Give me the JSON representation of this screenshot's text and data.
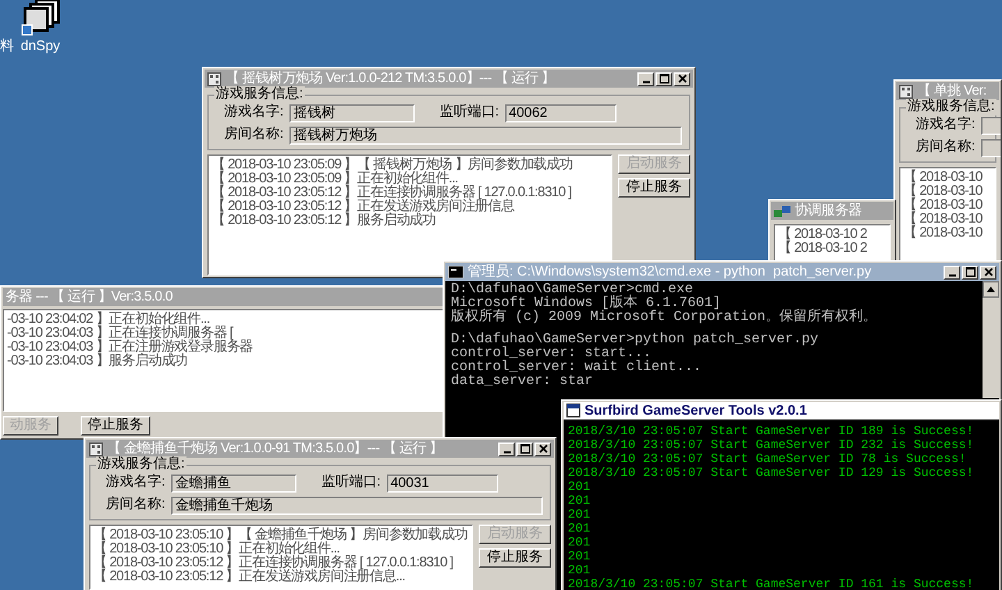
{
  "desktop_icons": [
    {
      "kind": "cut",
      "label": "料"
    },
    {
      "kind": "app",
      "label": "dnSpy"
    }
  ],
  "windows": [
    {
      "kind": "panel",
      "title": "务器 --- 【 运行 】Ver:3.5.0.0",
      "log": [
        "-03-10 23:04:02 】正在初始化组件...",
        "-03-10 23:04:03 】正在连接协调服务器 [",
        "-03-10 23:04:03 】正在注册游戏登录服务器",
        "-03-10 23:04:03 】服务启动成功"
      ],
      "buttons": [
        {
          "label": "动服务",
          "disabled": true
        },
        {
          "label": "停止服务",
          "disabled": false
        }
      ]
    },
    {
      "kind": "form",
      "title": "【 单挑 Ver:",
      "group_title": "游戏服务信息:",
      "field_rows": [
        {
          "fields": [
            {
              "label": "游戏名字:"
            }
          ]
        },
        {
          "fields": [
            {
              "label": "房间名称:"
            }
          ]
        }
      ],
      "log": [
        "【 2018-03-10",
        "【 2018-03-10",
        "【 2018-03-10",
        "【 2018-03-10",
        "【 2018-03-10"
      ]
    },
    {
      "kind": "form",
      "title": "协调服务器",
      "log": [
        "【 2018-03-10 2",
        "【 2018-03-10 2"
      ]
    },
    {
      "kind": "form",
      "title": "【 摇钱树万炮场 Ver:1.0.0-212 TM:3.5.0.0】--- 【 运行 】",
      "group_title": "游戏服务信息:",
      "field_rows": [
        {
          "fields": [
            {
              "label": "游戏名字:",
              "value": "摇钱树"
            },
            {
              "label": "监听端口:",
              "value": "40062"
            }
          ]
        },
        {
          "fields": [
            {
              "label": "房间名称:",
              "value": "摇钱树万炮场"
            }
          ]
        }
      ],
      "log": [
        "【 2018-03-10 23:05:09 】【 摇钱树万炮场 】房间参数加载成功",
        "【 2018-03-10 23:05:09 】正在初始化组件...",
        "【 2018-03-10 23:05:12 】正在连接协调服务器 [ 127.0.0.1:8310 ]",
        "【 2018-03-10 23:05:12 】正在发送游戏房间注册信息",
        "【 2018-03-10 23:05:12 】服务启动成功"
      ],
      "buttons": [
        {
          "label": "启动服务",
          "disabled": true
        },
        {
          "label": "停止服务",
          "disabled": false
        }
      ]
    },
    {
      "kind": "cmd",
      "title": "管理员: C:\\Windows\\system32\\cmd.exe - python  patch_server.py",
      "blocks": [
        {
          "lines": [
            "D:\\dafuhao\\GameServer>cmd.exe",
            "Microsoft Windows [版本 6.1.7601]",
            "版权所有 (c) 2009 Microsoft Corporation。保留所有权利。"
          ]
        },
        {
          "lines": [
            "D:\\dafuhao\\GameServer>python patch_server.py",
            "control_server: start...",
            "control_server: wait client...",
            "data_server: star"
          ]
        }
      ]
    },
    {
      "kind": "form",
      "title": "【 金蟾捕鱼千炮场 Ver:1.0.0-91 TM:3.5.0.0】--- 【 运行 】",
      "group_title": "游戏服务信息:",
      "field_rows": [
        {
          "fields": [
            {
              "label": "游戏名字:",
              "value": "金蟾捕鱼"
            },
            {
              "label": "监听端口:",
              "value": "40031"
            }
          ]
        },
        {
          "fields": [
            {
              "label": "房间名称:",
              "value": "金蟾捕鱼千炮场"
            }
          ]
        }
      ],
      "log": [
        "【 2018-03-10 23:05:10 】【 金蟾捕鱼千炮场 】房间参数加载成功",
        "【 2018-03-10 23:05:10 】正在初始化组件...",
        "【 2018-03-10 23:05:12 】正在连接协调服务器 [ 127.0.0.1:8310 ]",
        "【 2018-03-10 23:05:12 】正在发送游戏房间注册信息..."
      ],
      "buttons": [
        {
          "label": "启动服务",
          "disabled": true
        },
        {
          "label": "停止服务",
          "disabled": false
        }
      ]
    },
    {
      "kind": "tool",
      "title": "Surfbird GameServer Tools v2.0.1",
      "lines": [
        "2018/3/10 23:05:07 Start GameServer ID 189 is Success!",
        "2018/3/10 23:05:07 Start GameServer ID 232 is Success!",
        "2018/3/10 23:05:07 Start GameServer ID 78 is Success!",
        "2018/3/10 23:05:07 Start GameServer ID 129 is Success!",
        "201",
        "201",
        "201",
        "201",
        "201",
        "201",
        "201",
        "2018/3/10 23:05:07 Start GameServer ID 161 is Success!"
      ]
    }
  ]
}
